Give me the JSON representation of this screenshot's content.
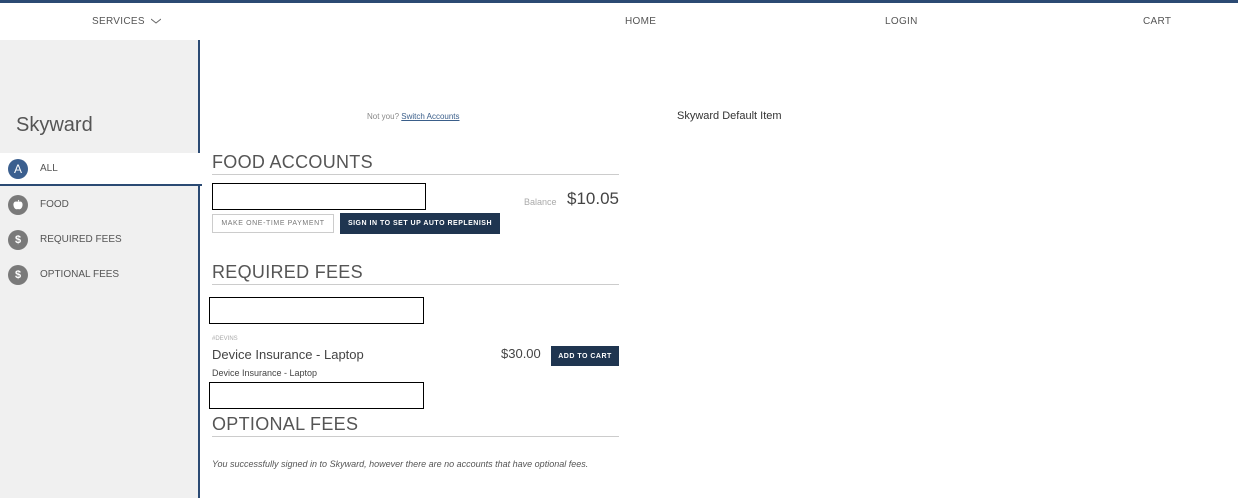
{
  "topnav": {
    "services": "SERVICES",
    "home": "HOME",
    "login": "LOGIN",
    "cart": "CART"
  },
  "sidebar": {
    "brand": "Skyward",
    "items": [
      {
        "label": "ALL",
        "icon_letter": "A"
      },
      {
        "label": "FOOD",
        "icon": "apple-icon"
      },
      {
        "label": "REQUIRED FEES",
        "icon_letter": "$"
      },
      {
        "label": "OPTIONAL FEES",
        "icon_letter": "$"
      }
    ]
  },
  "main": {
    "not_you": "Not you?",
    "switch_accounts": "Switch Accounts",
    "default_item": "Skyward Default Item",
    "food": {
      "title": "FOOD ACCOUNTS",
      "balance_label": "Balance",
      "balance_value": "$10.05",
      "one_time_button": "MAKE ONE-TIME PAYMENT",
      "auto_replenish_button": "SIGN IN TO SET UP AUTO REPLENISH"
    },
    "required": {
      "title": "REQUIRED FEES",
      "fee_tag": "#DEVINS",
      "fee_name": "Device Insurance - Laptop",
      "fee_sub": "Device Insurance - Laptop",
      "fee_price": "$30.00",
      "add_to_cart": "ADD TO CART"
    },
    "optional": {
      "title": "OPTIONAL FEES",
      "message": "You successfully signed in to Skyward, however there are no accounts that have optional fees."
    }
  },
  "colors": {
    "accent": "#2b4a73",
    "dark_button": "#1f3550",
    "sidebar_bg": "#f0f0f0"
  }
}
